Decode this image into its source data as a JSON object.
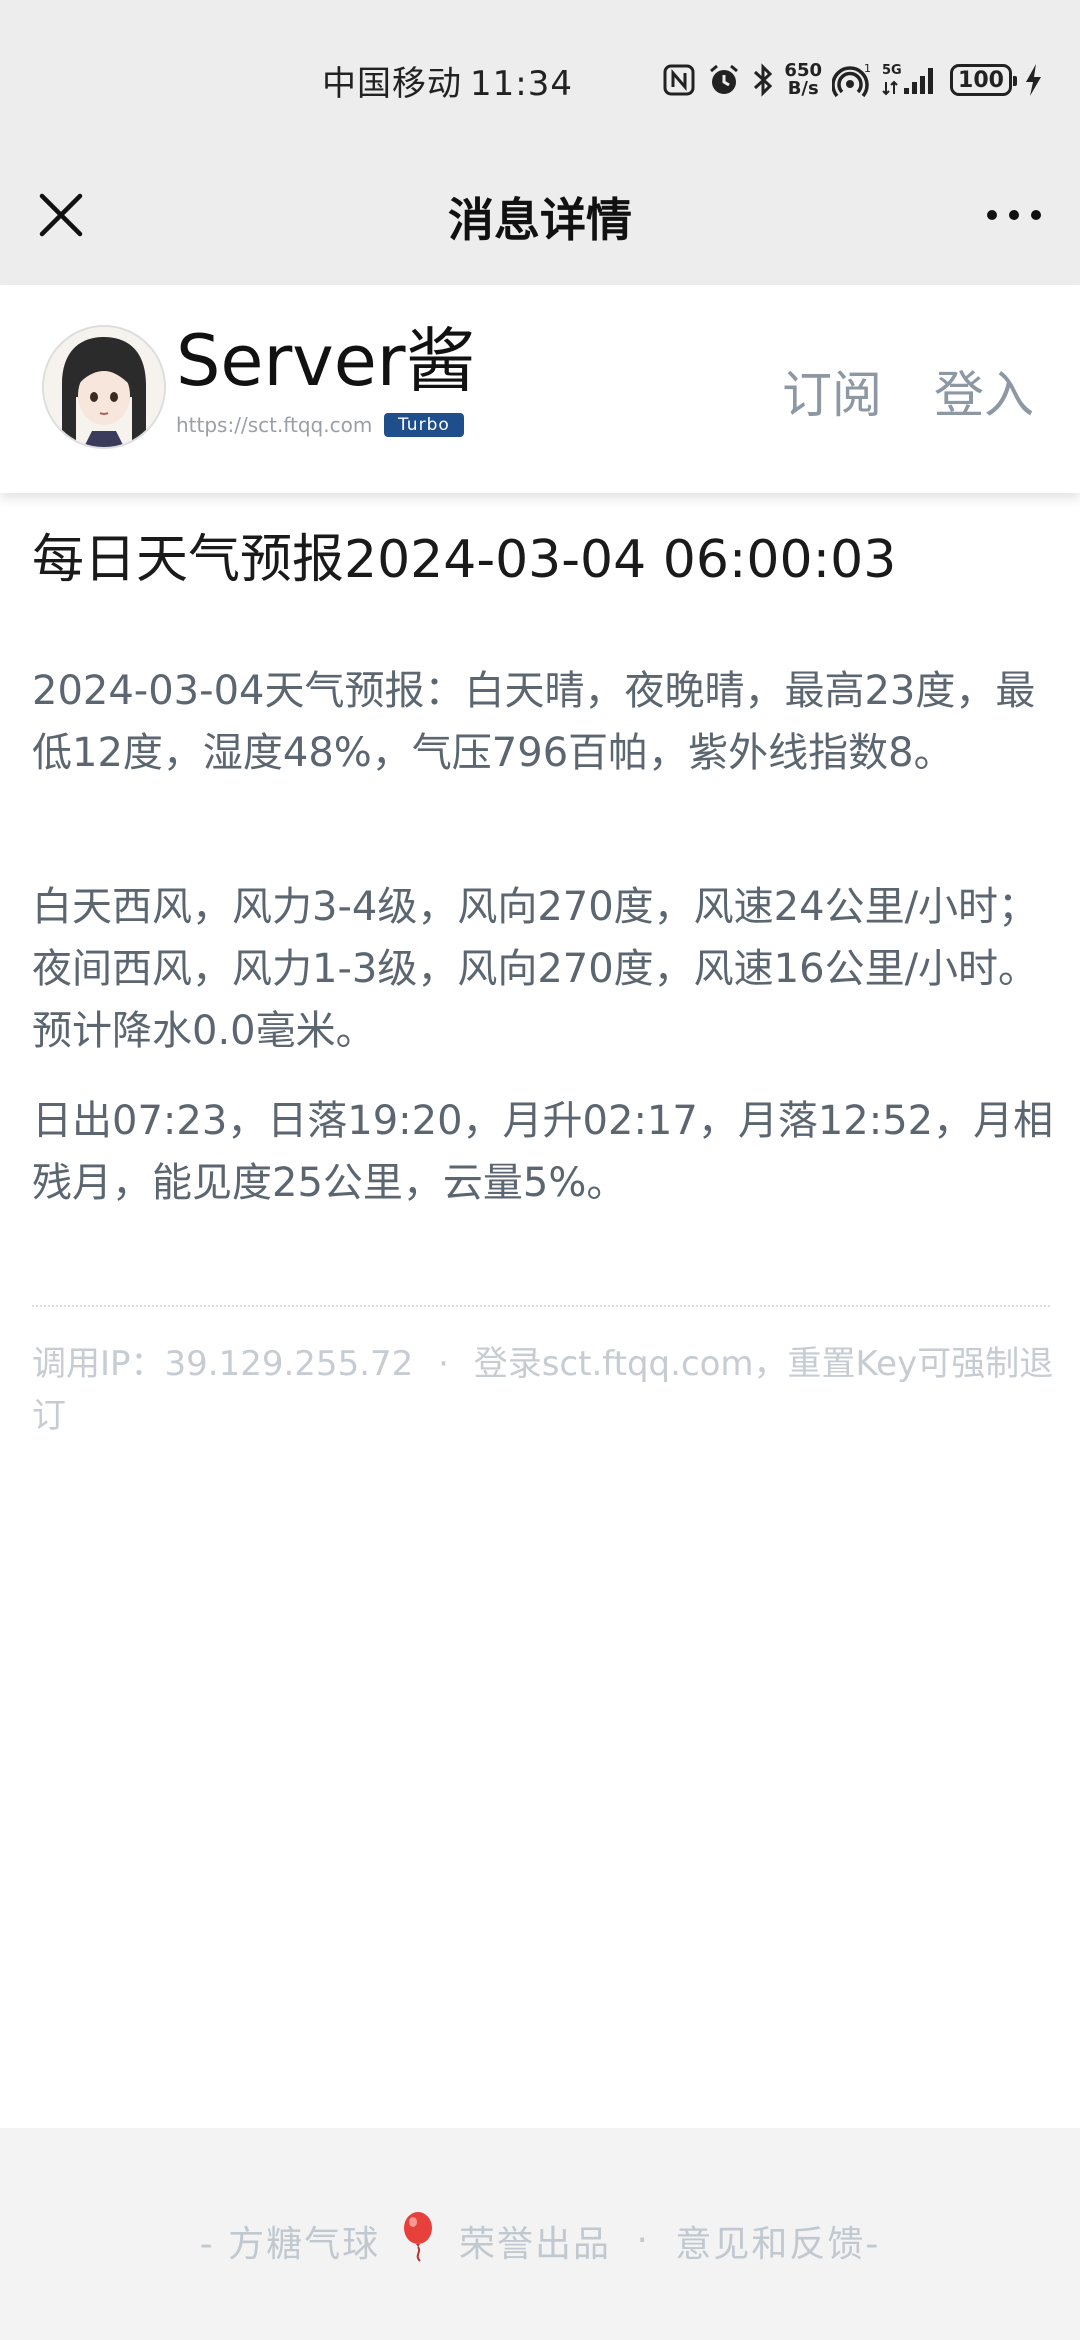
{
  "status_bar": {
    "carrier": "中国移动",
    "time": "11:34",
    "net_speed_value": "650",
    "net_speed_unit": "B/s",
    "signal_label": "5G",
    "battery": "100",
    "icons": [
      "nfc-icon",
      "alarm-icon",
      "bluetooth-icon",
      "hotspot-icon",
      "signal-icon",
      "battery-icon",
      "charging-icon"
    ]
  },
  "nav": {
    "title": "消息详情",
    "icons": [
      "close-icon",
      "more-icon"
    ]
  },
  "site": {
    "brand": "Server酱",
    "url": "https://sct.ftqq.com",
    "badge": "Turbo",
    "subscribe": "订阅",
    "login": "登入",
    "badge_color": "#1f4e8c"
  },
  "message": {
    "title": "每日天气预报2024-03-04 06:00:03",
    "paragraphs": [
      "2024-03-04天气预报：白天晴，夜晚晴，最高23度，最低12度，湿度48%，气压796百帕，紫外线指数8。",
      "白天西风，风力3-4级，风向270度，风速24公里/小时；夜间西风，风力1-3级，风向270度，风速16公里/小时。预计降水0.0毫米。",
      "日出07:23，日落19:20，月升02:17，月落12:52，月相残月，能见度25公里，云量5%。"
    ]
  },
  "meta": {
    "ip_label": "调用IP：39.129.255.72",
    "separator": "·",
    "hint": "登录sct.ftqq.com，重置Key可强制退订"
  },
  "footer": {
    "prefix": "- 方糖气球",
    "middle": "荣誉出品",
    "separator": "·",
    "feedback": "意见和反馈-",
    "balloon_color": "#e8403a"
  }
}
